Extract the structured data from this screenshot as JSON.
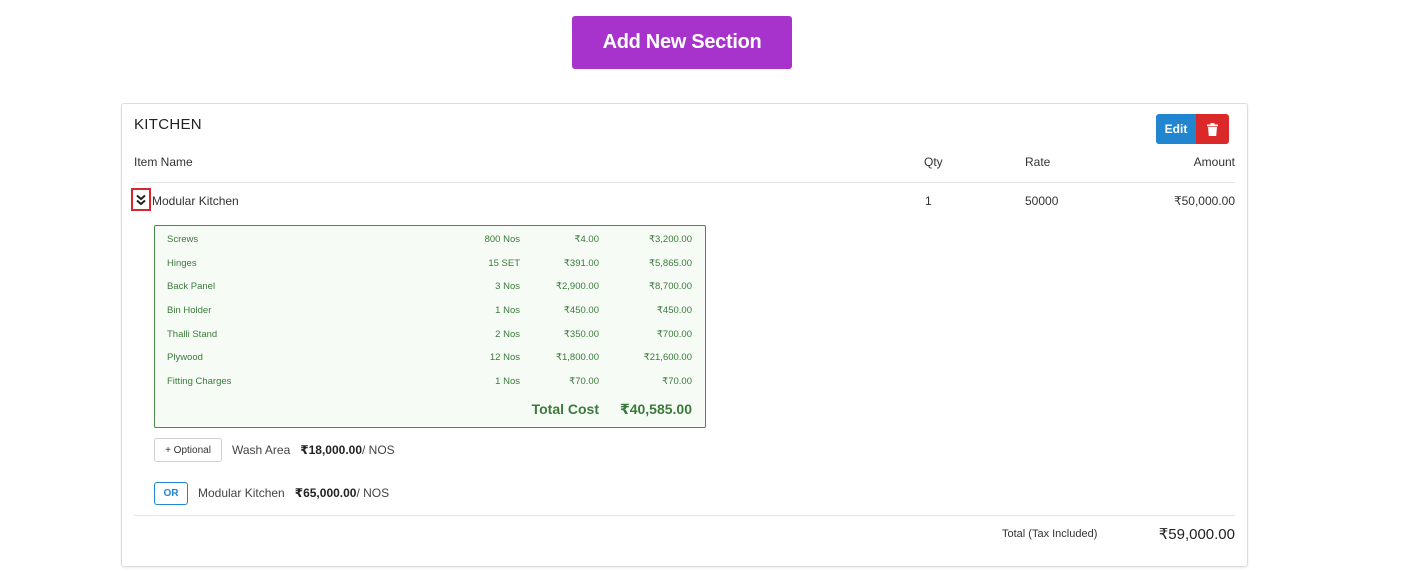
{
  "header": {
    "add_section_label": "Add New Section"
  },
  "section": {
    "title": "KITCHEN",
    "edit_label": "Edit",
    "columns": {
      "item_name": "Item Name",
      "qty": "Qty",
      "rate": "Rate",
      "amount": "Amount"
    },
    "item": {
      "name": "Modular Kitchen",
      "qty": "1",
      "rate": "50000",
      "amount": "₹50,000.00"
    },
    "materials": [
      {
        "name": "Screws",
        "qty": "800 Nos",
        "rate": "₹4.00",
        "amount": "₹3,200.00"
      },
      {
        "name": "Hinges",
        "qty": "15 SET",
        "rate": "₹391.00",
        "amount": "₹5,865.00"
      },
      {
        "name": "Back Panel",
        "qty": "3 Nos",
        "rate": "₹2,900.00",
        "amount": "₹8,700.00"
      },
      {
        "name": "Bin Holder",
        "qty": "1 Nos",
        "rate": "₹450.00",
        "amount": "₹450.00"
      },
      {
        "name": "Thalli Stand",
        "qty": "2 Nos",
        "rate": "₹350.00",
        "amount": "₹700.00"
      },
      {
        "name": "Plywood",
        "qty": "12 Nos",
        "rate": "₹1,800.00",
        "amount": "₹21,600.00"
      },
      {
        "name": "Fitting Charges",
        "qty": "1 Nos",
        "rate": "₹70.00",
        "amount": "₹70.00"
      }
    ],
    "total_cost_label": "Total Cost",
    "total_cost_value": "₹40,585.00",
    "optional": {
      "button_label": "+ Optional",
      "name": "Wash Area",
      "price": "₹18,000.00",
      "unit": "/ NOS"
    },
    "alternative": {
      "button_label": "OR",
      "name": "Modular Kitchen",
      "price": "₹65,000.00",
      "unit": "/ NOS"
    },
    "grand_total_label": "Total (Tax Included)",
    "grand_total_value": "₹59,000.00"
  },
  "colors": {
    "add_section_bg": "#a833cc",
    "edit_bg": "#2185d0",
    "delete_bg": "#db2828",
    "materials_text": "#3b7a3b",
    "expand_border": "#d9262c"
  },
  "icons": {
    "delete": "trash-icon",
    "expand": "double-chevron-down-icon"
  }
}
